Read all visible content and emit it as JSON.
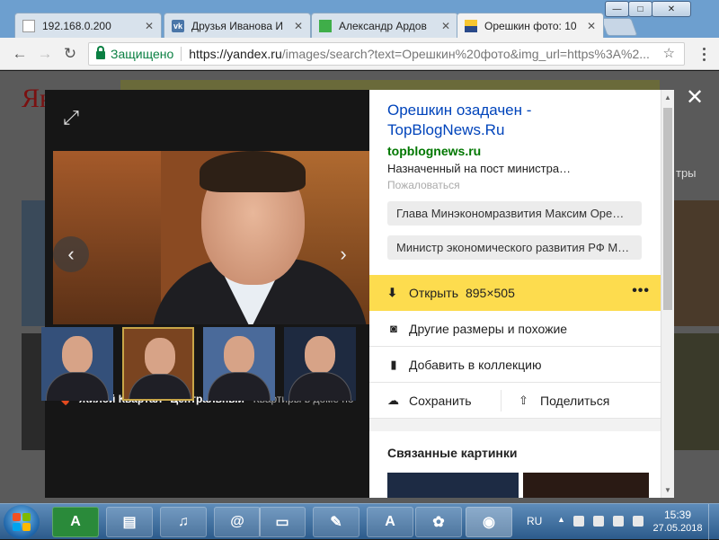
{
  "tabs": [
    {
      "title": "192.168.0.200",
      "icon": "page-icon",
      "active": false
    },
    {
      "title": "Друзья Иванова И",
      "icon": "vk-icon",
      "active": false
    },
    {
      "title": "Александр Ардов",
      "icon": "green-square-icon",
      "active": false
    },
    {
      "title": "Орешкин фото: 10",
      "icon": "image-icon",
      "active": true
    }
  ],
  "window_controls": {
    "minimize": "—",
    "maximize": "□",
    "close": "✕"
  },
  "address_bar": {
    "secure_label": "Защищено",
    "url_host": "https://yandex.ru",
    "url_rest": "/images/search?text=Орешкин%20фото&img_url=https%3A%2..."
  },
  "page": {
    "logo_text": "Ян",
    "filters_text": "тры"
  },
  "viewer": {
    "expand_icon": "⤢",
    "crop_icon": "⌗",
    "prev_arrow": "‹",
    "next_arrow": "›",
    "ad_title": "Жилой Квартал \"Центральный\"",
    "ad_text": "Квартиры в доме по"
  },
  "panel": {
    "title": "Орешкин озадачен - TopBlogNews.Ru",
    "site": "topblognews.ru",
    "description": "Назначенный на пост министра…",
    "complain": "Пожаловаться",
    "tags": [
      "Глава Минэкономразвития Максим Оре…",
      "Министр экономического развития РФ М…"
    ],
    "open_label": "Открыть",
    "open_size": "895×505",
    "more": "•••",
    "other_sizes": "Другие размеры и похожие",
    "add_collection": "Добавить в коллекцию",
    "save": "Сохранить",
    "share": "Поделиться",
    "related": "Связанные картинки"
  },
  "close_overlay": "✕",
  "taskbar": {
    "lang": "RU",
    "time": "15:39",
    "date": "27.05.2018"
  },
  "colors": {
    "accent_yellow": "#fddc4e",
    "link_blue": "#0044bb",
    "site_green": "#007700",
    "secure_green": "#0b8043"
  }
}
